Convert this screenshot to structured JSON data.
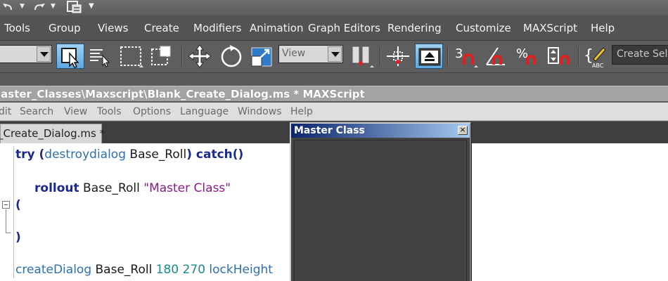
{
  "quick_access": {
    "undo_icon": "undo-icon",
    "redo_icon": "redo-icon",
    "project_icon": "project-folder-icon"
  },
  "menu": {
    "items": [
      "Tools",
      "Group",
      "Views",
      "Create",
      "Modifiers",
      "Animation",
      "Graph Editors",
      "Rendering",
      "Customize",
      "MAXScript",
      "Help"
    ]
  },
  "toolbar": {
    "reference_coord_value": "View",
    "search_placeholder": "Create Sele"
  },
  "editor": {
    "title": "laster_Classes\\Maxscript\\Blank_Create_Dialog.ms * MAXScript",
    "menu": [
      "dit",
      "Search",
      "View",
      "Tools",
      "Options",
      "Language",
      "Windows",
      "Help"
    ],
    "tab_label": "_Create_Dialog.ms *",
    "code": {
      "line1": {
        "kw1": "try",
        "p1": " (",
        "fn": "destroydialog",
        "id": " Base_Roll",
        "p2": ")",
        "kw2": " catch",
        "p3": "()"
      },
      "line2": {
        "kw": "rollout",
        "id": " Base_Roll ",
        "str": "\"Master Class\""
      },
      "line3": "(",
      "line4": ")",
      "line5": {
        "fn": "createDialog",
        "id": " Base_Roll ",
        "n1": "180",
        "n2": " 270",
        "kw": " lockHeight"
      }
    }
  },
  "dialog": {
    "title": "Master Class",
    "close_label": "×"
  },
  "colors": {
    "dialog_title_start": "#0a246a",
    "dialog_title_end": "#a6caf0",
    "select_active": "#5ea8df"
  }
}
